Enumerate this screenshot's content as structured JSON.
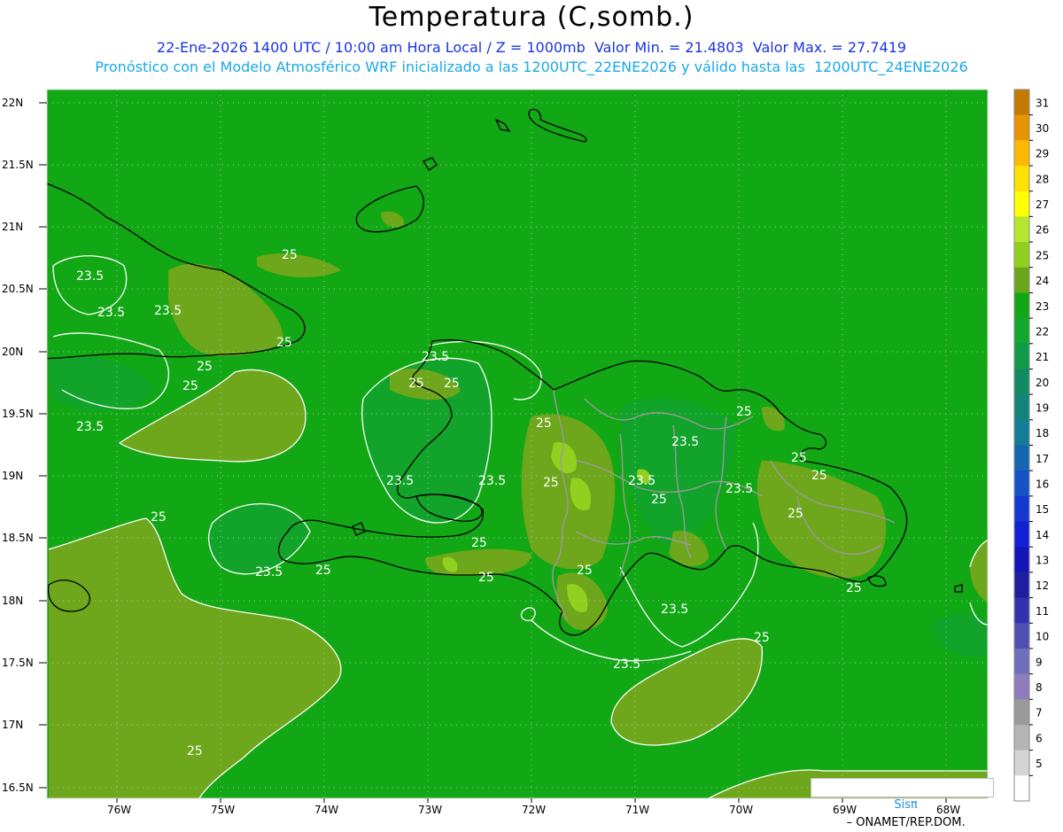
{
  "header": {
    "title": "Temperatura (C,somb.)",
    "line1": "22-Ene-2026 1400 UTC / 10:00 am Hora Local / Z = 1000mb  Valor Min. = 21.4803  Valor Max. = 27.7419",
    "line2": "Pronóstico con el Modelo Atmosférico WRF inicializado a las 1200UTC_22ENE2026 y válido hasta las  1200UTC_24ENE2026"
  },
  "map": {
    "background_color": "#12a714",
    "lat_labels": [
      "22N",
      "21.5N",
      "21N",
      "20.5N",
      "20N",
      "19.5N",
      "19N",
      "18.5N",
      "18N",
      "17.5N",
      "17N",
      "16.5N"
    ],
    "lon_labels": [
      "76W",
      "75W",
      "74W",
      "73W",
      "72W",
      "71W",
      "70W",
      "69W",
      "68W"
    ],
    "contour_labels": [
      "25",
      "23.5",
      "23.5",
      "23.5",
      "25",
      "25",
      "25",
      "23.5",
      "23.5",
      "25",
      "25",
      "25",
      "23.5",
      "23.5",
      "23.5",
      "25",
      "25",
      "25",
      "25",
      "23.5",
      "25",
      "25",
      "25",
      "23.5",
      "25",
      "25",
      "25",
      "25",
      "23.5",
      "23.5",
      "25",
      "23.5",
      "25",
      "25"
    ]
  },
  "colorbar": {
    "ticks": [
      "31",
      "30",
      "29",
      "28",
      "27",
      "26",
      "25",
      "24",
      "23",
      "22",
      "21",
      "20",
      "19",
      "18",
      "17",
      "16",
      "15",
      "14",
      "13",
      "12",
      "11",
      "10",
      "9",
      "8",
      "7",
      "6",
      "5"
    ],
    "colors": [
      "#c47a00",
      "#e89400",
      "#ffb800",
      "#ffe000",
      "#ffff00",
      "#b8e62e",
      "#92d020",
      "#6aa61c",
      "#12a714",
      "#11a830",
      "#0f9a48",
      "#108a62",
      "#138278",
      "#147c96",
      "#1466b0",
      "#1452c6",
      "#1438d2",
      "#1420d6",
      "#1414b8",
      "#1e1e9e",
      "#3232b0",
      "#5050b4",
      "#6e6ebc",
      "#8e7cbc",
      "#9a9a9a",
      "#b4b4b4",
      "#d4d4d4",
      "#ffffff"
    ]
  },
  "footer": {
    "credit_symbol": "Sisπ",
    "credit_org": "– ONAMET/REP.DOM."
  }
}
